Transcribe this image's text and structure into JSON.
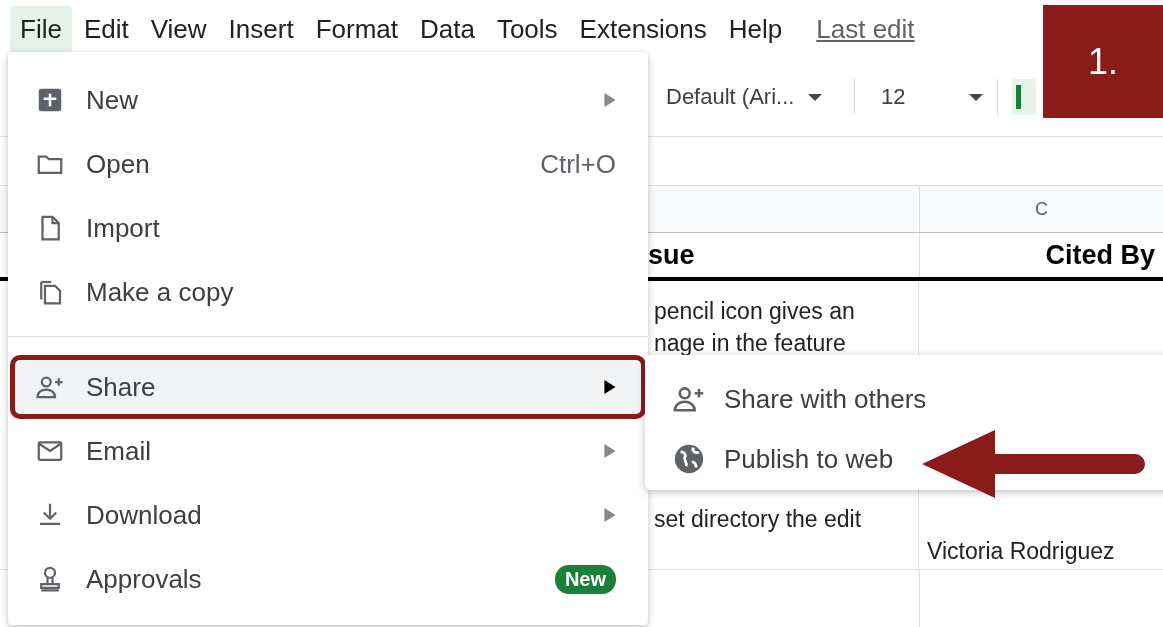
{
  "menu_bar": [
    {
      "label": "File",
      "selected": true
    },
    {
      "label": "Edit",
      "selected": false
    },
    {
      "label": "View",
      "selected": false
    },
    {
      "label": "Insert",
      "selected": false
    },
    {
      "label": "Format",
      "selected": false
    },
    {
      "label": "Data",
      "selected": false
    },
    {
      "label": "Tools",
      "selected": false
    },
    {
      "label": "Extensions",
      "selected": false
    },
    {
      "label": "Help",
      "selected": false
    }
  ],
  "last_edit_link": "Last edit",
  "step_badge": "1.",
  "toolbar": {
    "font": "Default (Ari...",
    "font_size": "12"
  },
  "sheet": {
    "column_header": "C",
    "header_row": {
      "column_b": "sue",
      "column_c": "Cited By"
    },
    "row_2": {
      "column_b_top": [
        "pencil icon gives an",
        "nage in the feature"
      ],
      "column_b_bottom": "set directory the edit",
      "column_c": "Victoria Rodriguez"
    }
  },
  "file_menu": [
    {
      "kind": "item",
      "label": "New",
      "submenu": true,
      "selected": false
    },
    {
      "kind": "item",
      "label": "Open",
      "shortcut": "Ctrl+O",
      "selected": false
    },
    {
      "kind": "item",
      "label": "Import",
      "selected": false
    },
    {
      "kind": "item",
      "label": "Make a copy",
      "selected": false
    },
    {
      "kind": "divider"
    },
    {
      "kind": "item",
      "label": "Share",
      "submenu": true,
      "selected": true
    },
    {
      "kind": "item",
      "label": "Email",
      "submenu": true,
      "selected": false
    },
    {
      "kind": "item",
      "label": "Download",
      "submenu": true,
      "selected": false
    },
    {
      "kind": "item",
      "label": "Approvals",
      "badge": "New",
      "selected": false
    }
  ],
  "share_submenu": [
    {
      "label": "Share with others"
    },
    {
      "label": "Publish to web"
    }
  ]
}
